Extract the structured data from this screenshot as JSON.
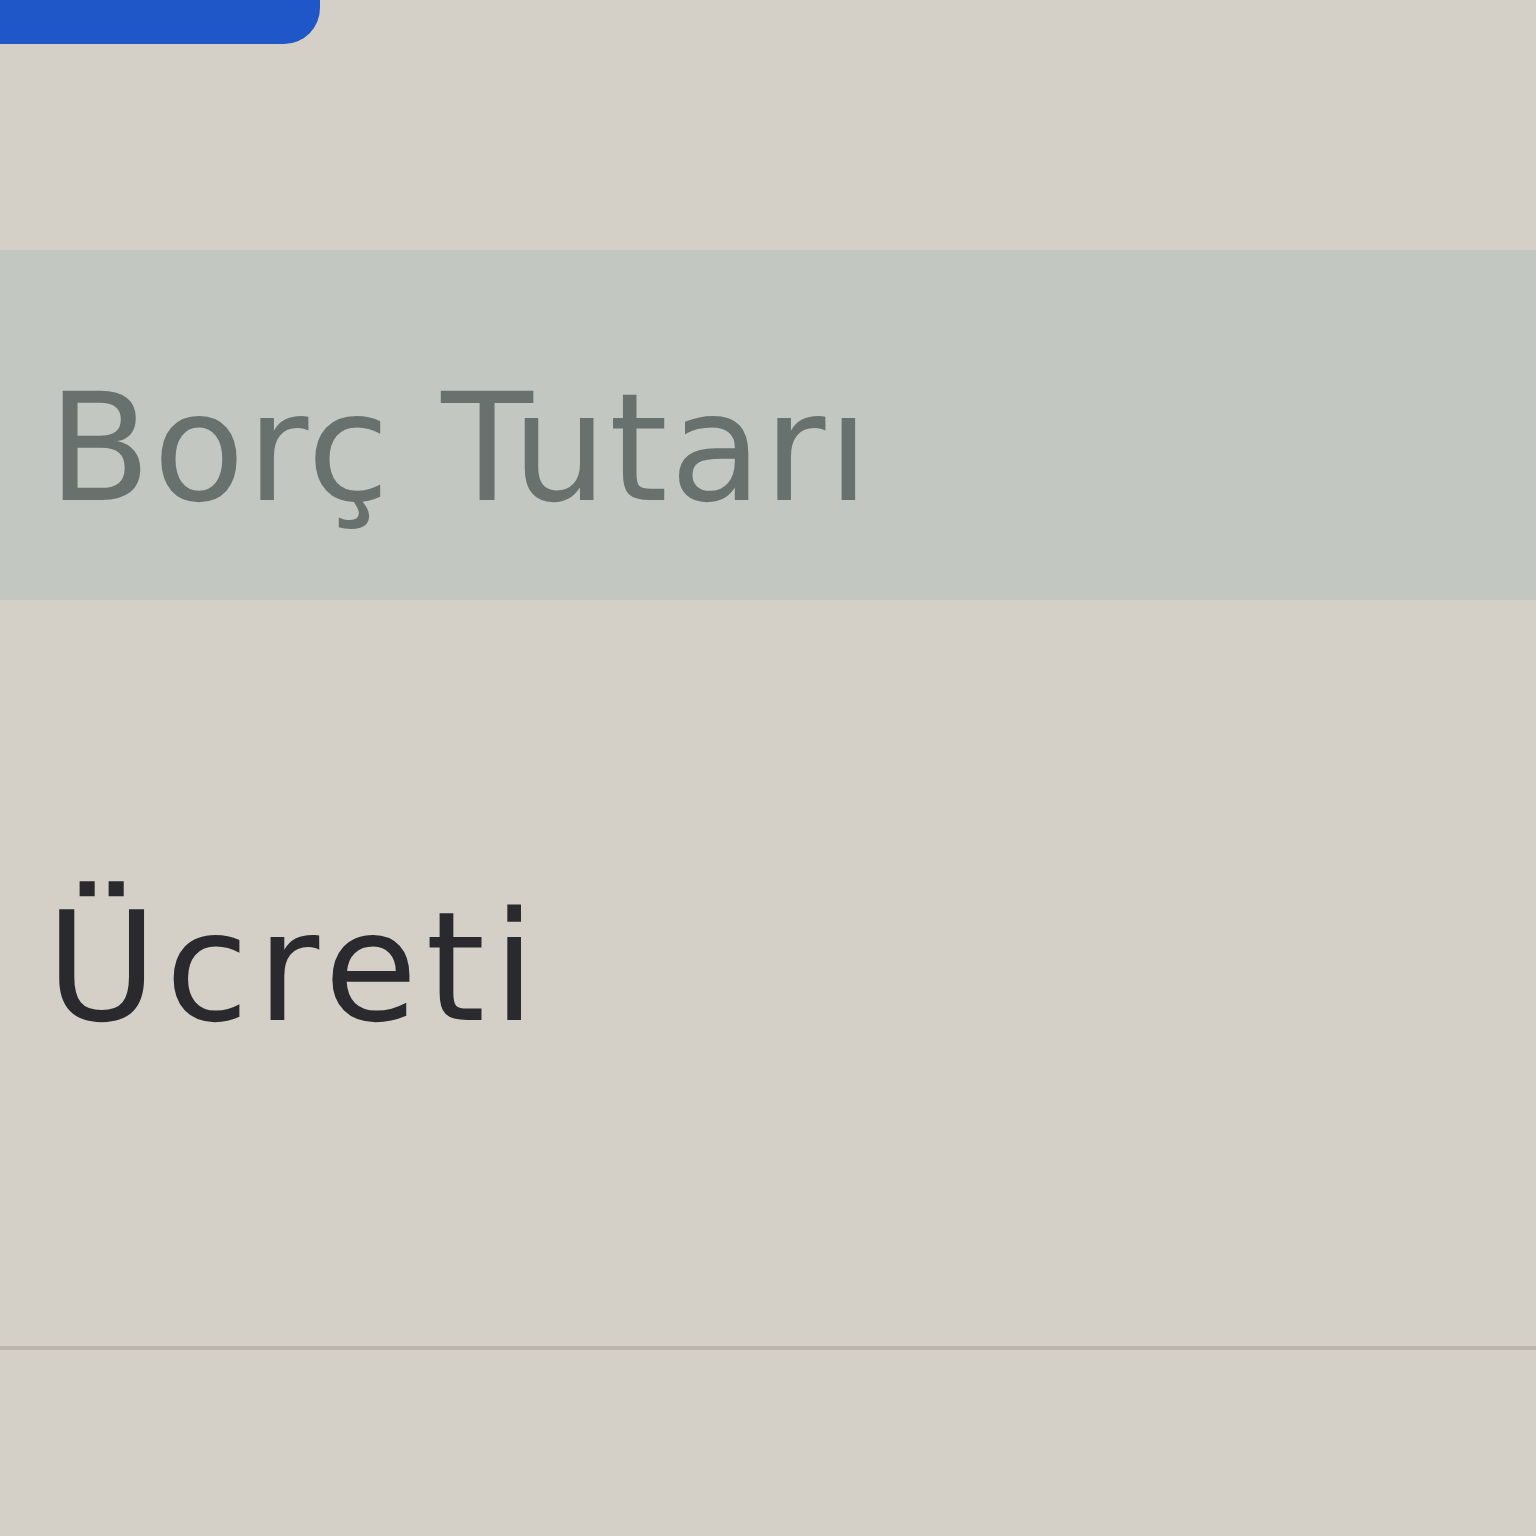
{
  "table": {
    "header": {
      "label": "Borç Tutarı"
    },
    "rows": [
      {
        "label": "Ücreti"
      }
    ]
  }
}
